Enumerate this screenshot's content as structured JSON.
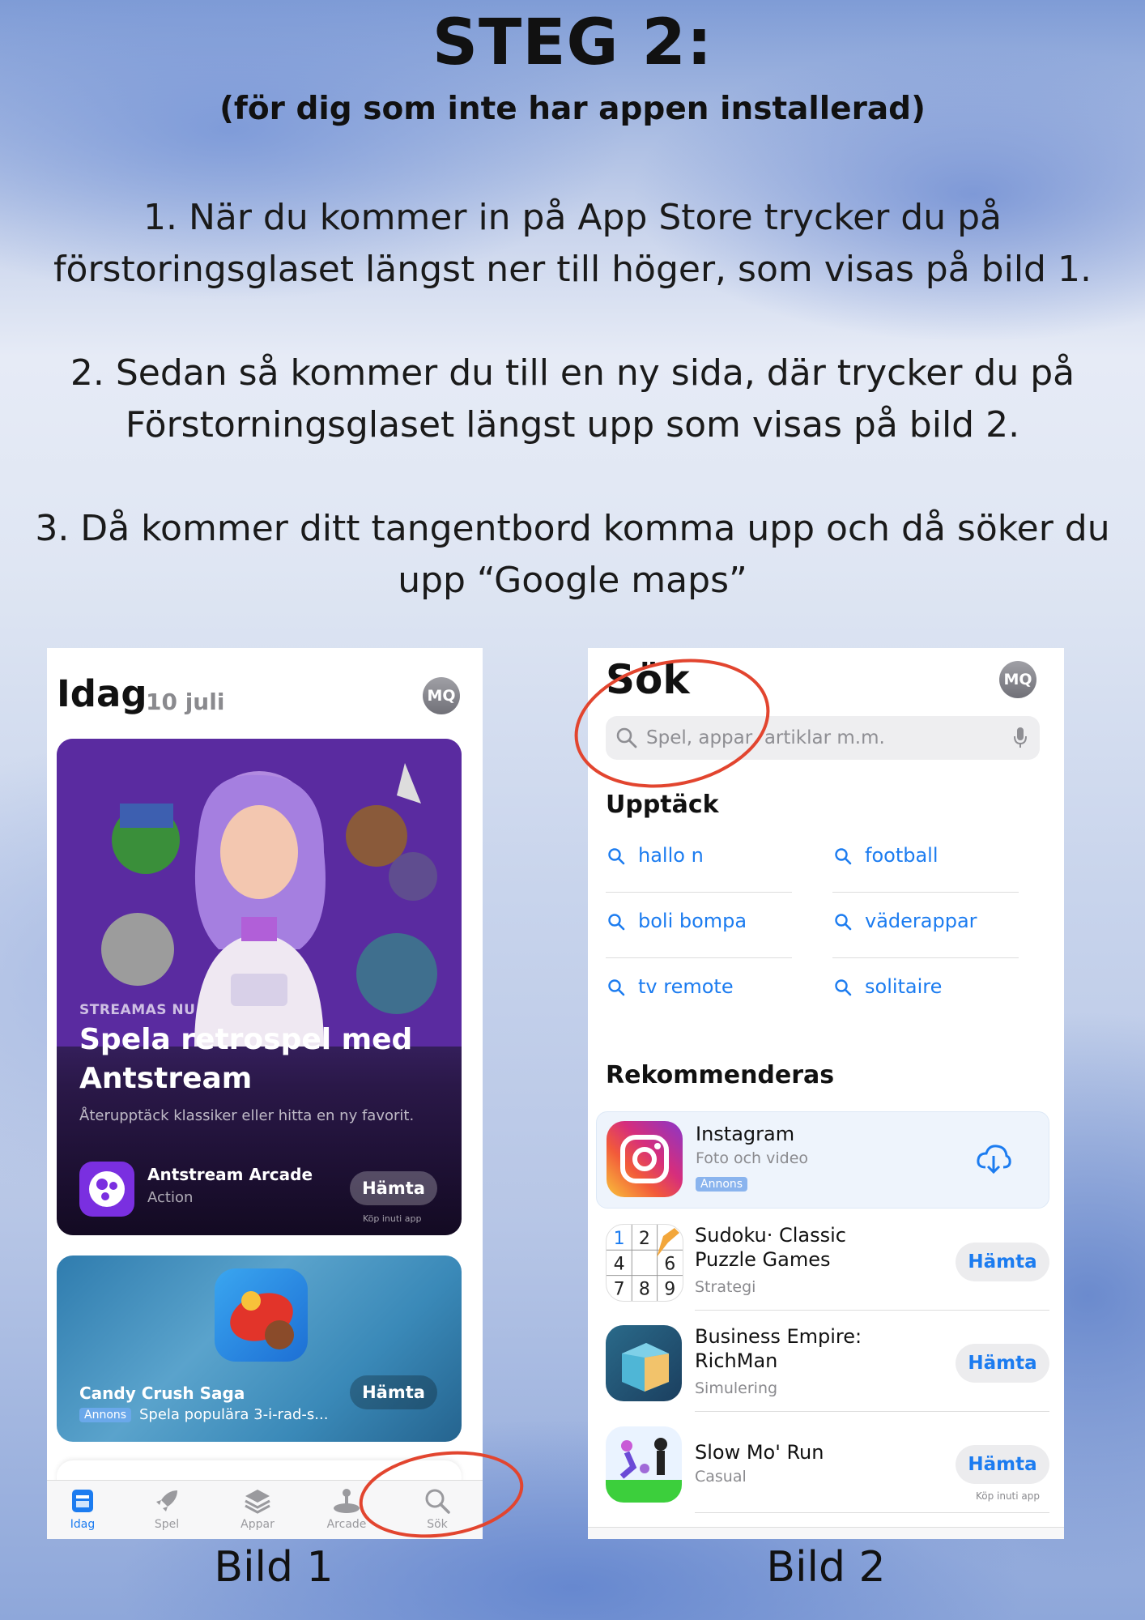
{
  "heading": {
    "title": "STEG 2:",
    "subtitle": "(för dig som inte har appen installerad)"
  },
  "steps": {
    "s1": "1. När du kommer in på App Store trycker du på förstoringsglaset längst ner till höger, som visas på bild 1.",
    "s2": "2. Sedan så kommer du till en ny sida, där trycker du på Förstorningsglaset längst upp som visas på bild 2.",
    "s3": "3. Då kommer ditt tangentbord komma upp och då söker du upp “Google maps”"
  },
  "captions": {
    "left": "Bild 1",
    "right": "Bild 2"
  },
  "colors": {
    "accent": "#1c7cf0",
    "annotation": "#e2452f",
    "ad_badge": "#8ab4ee"
  },
  "screen1": {
    "title": "Idag",
    "date": "10 juli",
    "avatar": "MQ",
    "featured": {
      "tag": "STREAMAS NU",
      "title": "Spela retrospel med Antstream",
      "subtitle": "Återupptäck klassiker eller hitta en ny favorit.",
      "app_name": "Antstream Arcade",
      "app_category": "Action",
      "button": "Hämta",
      "note": "Köp inuti app"
    },
    "card2": {
      "app_name": "Candy Crush Saga",
      "ad_label": "Annons",
      "desc": "Spela populära 3-i-rad-s...",
      "button": "Hämta"
    },
    "tabs": [
      {
        "label": "Idag",
        "icon": "today-icon"
      },
      {
        "label": "Spel",
        "icon": "rocket-icon"
      },
      {
        "label": "Appar",
        "icon": "layers-icon"
      },
      {
        "label": "Arcade",
        "icon": "joystick-icon"
      },
      {
        "label": "Sök",
        "icon": "search-icon"
      }
    ]
  },
  "screen2": {
    "title": "Sök",
    "avatar": "MQ",
    "search_placeholder": "Spel, appar, artiklar m.m.",
    "discover_heading": "Upptäck",
    "suggestions": [
      "hallo n",
      "football",
      "boli bompa",
      "väderappar",
      "tv remote",
      "solitaire"
    ],
    "recommended_heading": "Rekommenderas",
    "apps": [
      {
        "name": "Instagram",
        "category": "Foto och video",
        "badge": "Annons",
        "action": "cloud-download-icon"
      },
      {
        "name": "Sudoku· Classic",
        "name2": "Puzzle Games",
        "category": "Strategi",
        "button": "Hämta"
      },
      {
        "name": "Business Empire:",
        "name2": "RichMan",
        "category": "Simulering",
        "button": "Hämta"
      },
      {
        "name": "Slow Mo' Run",
        "category": "Casual",
        "button": "Hämta",
        "note": "Köp inuti app"
      }
    ],
    "sudoku_digits": [
      "1",
      "2",
      "",
      "4",
      "",
      "6",
      "7",
      "8",
      "9"
    ]
  }
}
